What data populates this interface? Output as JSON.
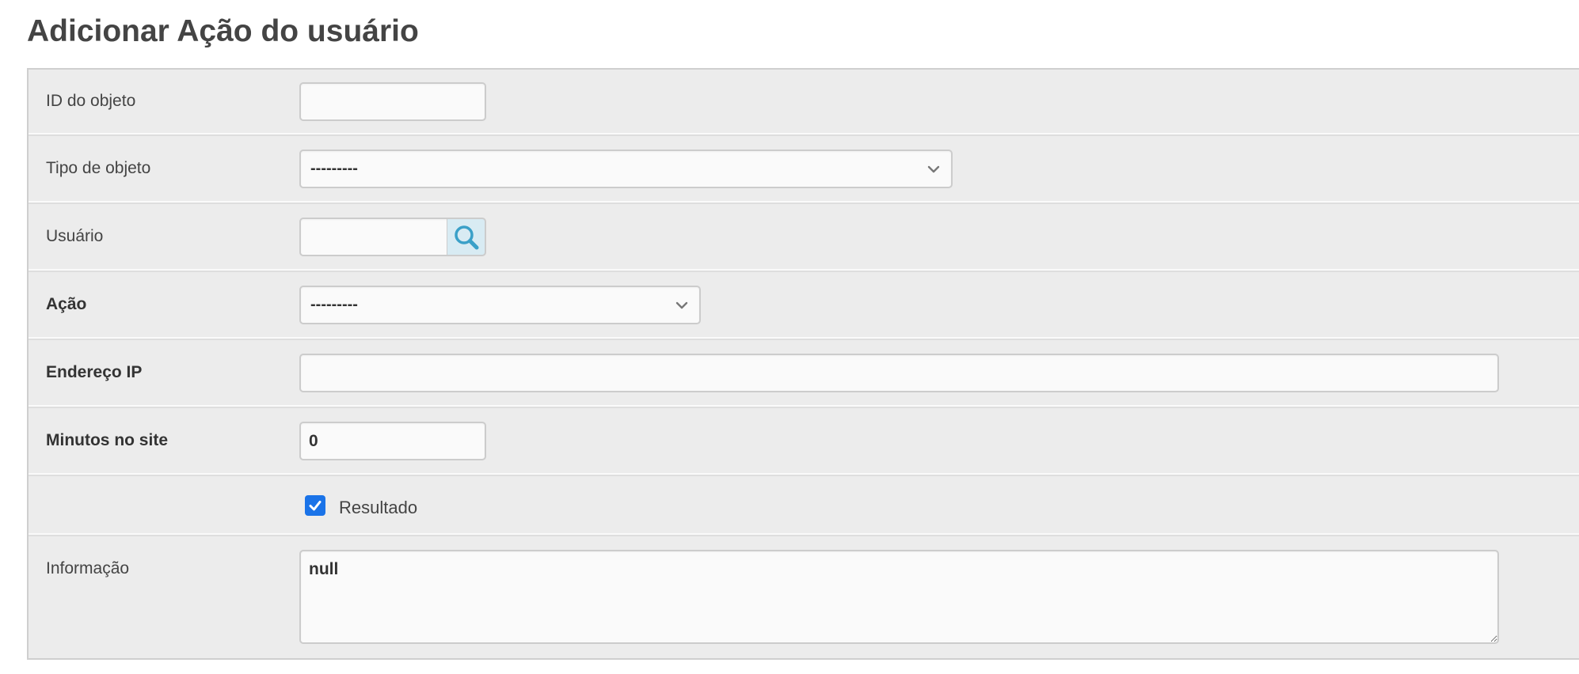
{
  "page": {
    "title": "Adicionar Ação do usuário"
  },
  "form": {
    "object_id": {
      "label": "ID do objeto",
      "value": ""
    },
    "object_type": {
      "label": "Tipo de objeto",
      "selected": "---------"
    },
    "user": {
      "label": "Usuário",
      "value": "",
      "lookup_icon": "search-icon"
    },
    "action": {
      "label": "Ação",
      "selected": "---------"
    },
    "ip_address": {
      "label": "Endereço IP",
      "value": ""
    },
    "minutes_on_site": {
      "label": "Minutos no site",
      "value": "0"
    },
    "result": {
      "label": "Resultado",
      "checked": true
    },
    "information": {
      "label": "Informação",
      "value": "null"
    }
  },
  "colors": {
    "checkbox_accent": "#1a73e8",
    "lookup_button_bg": "#d8ebf3",
    "lookup_icon": "#3aa0c8",
    "row_bg": "#ececec",
    "field_bg": "#fafafa"
  }
}
